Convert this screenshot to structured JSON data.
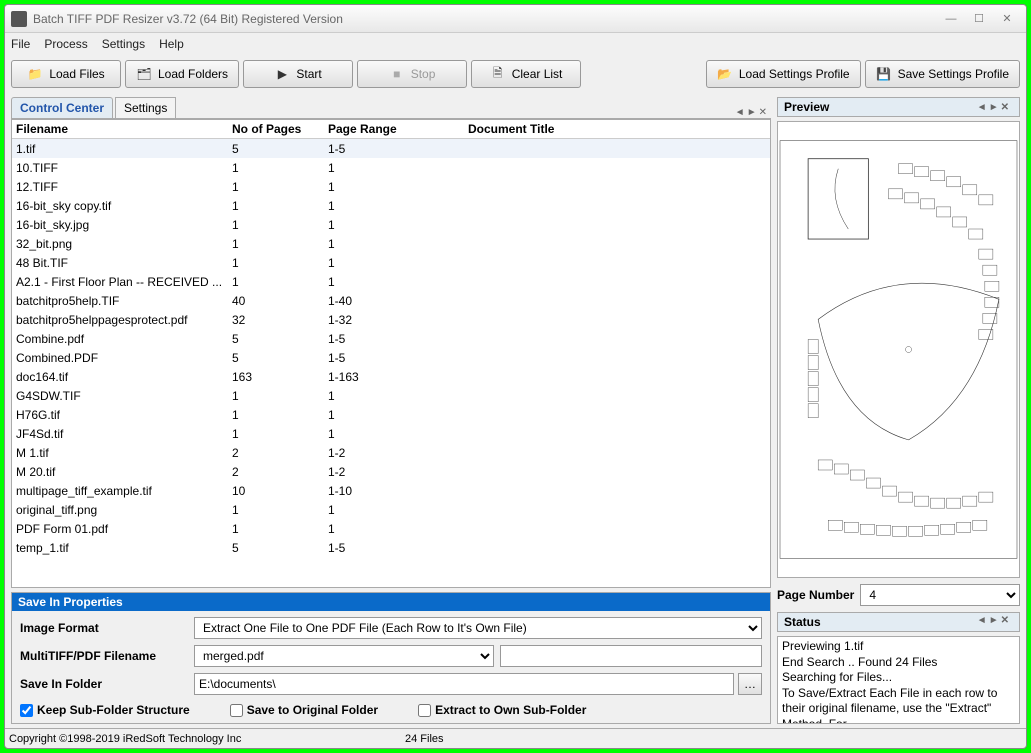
{
  "window": {
    "title": "Batch TIFF PDF Resizer v3.72 (64 Bit)  Registered Version"
  },
  "menu": {
    "file": "File",
    "process": "Process",
    "settings": "Settings",
    "help": "Help"
  },
  "toolbar": {
    "load_files": "Load Files",
    "load_folders": "Load Folders",
    "start": "Start",
    "stop": "Stop",
    "clear_list": "Clear List",
    "load_profile": "Load Settings Profile",
    "save_profile": "Save Settings Profile"
  },
  "tabs": {
    "control_center": "Control Center",
    "settings": "Settings"
  },
  "table": {
    "headers": {
      "filename": "Filename",
      "pages": "No of Pages",
      "range": "Page Range",
      "title": "Document Title"
    },
    "rows": [
      {
        "f": "1.tif",
        "p": "5",
        "r": "1-5",
        "t": ""
      },
      {
        "f": "10.TIFF",
        "p": "1",
        "r": "1",
        "t": ""
      },
      {
        "f": "12.TIFF",
        "p": "1",
        "r": "1",
        "t": ""
      },
      {
        "f": "16-bit_sky copy.tif",
        "p": "1",
        "r": "1",
        "t": ""
      },
      {
        "f": "16-bit_sky.jpg",
        "p": "1",
        "r": "1",
        "t": ""
      },
      {
        "f": "32_bit.png",
        "p": "1",
        "r": "1",
        "t": ""
      },
      {
        "f": "48 Bit.TIF",
        "p": "1",
        "r": "1",
        "t": ""
      },
      {
        "f": "A2.1 - First Floor Plan -- RECEIVED ...",
        "p": "1",
        "r": "1",
        "t": ""
      },
      {
        "f": "batchitpro5help.TIF",
        "p": "40",
        "r": "1-40",
        "t": ""
      },
      {
        "f": "batchitpro5helppagesprotect.pdf",
        "p": "32",
        "r": "1-32",
        "t": ""
      },
      {
        "f": "Combine.pdf",
        "p": "5",
        "r": "1-5",
        "t": ""
      },
      {
        "f": "Combined.PDF",
        "p": "5",
        "r": "1-5",
        "t": ""
      },
      {
        "f": "doc164.tif",
        "p": "163",
        "r": "1-163",
        "t": ""
      },
      {
        "f": "G4SDW.TIF",
        "p": "1",
        "r": "1",
        "t": ""
      },
      {
        "f": "H76G.tif",
        "p": "1",
        "r": "1",
        "t": ""
      },
      {
        "f": "JF4Sd.tif",
        "p": "1",
        "r": "1",
        "t": ""
      },
      {
        "f": "M 1.tif",
        "p": "2",
        "r": "1-2",
        "t": ""
      },
      {
        "f": "M 20.tif",
        "p": "2",
        "r": "1-2",
        "t": ""
      },
      {
        "f": "multipage_tiff_example.tif",
        "p": "10",
        "r": "1-10",
        "t": ""
      },
      {
        "f": "original_tiff.png",
        "p": "1",
        "r": "1",
        "t": ""
      },
      {
        "f": "PDF Form 01.pdf",
        "p": "1",
        "r": "1",
        "t": ""
      },
      {
        "f": "temp_1.tif",
        "p": "5",
        "r": "1-5",
        "t": ""
      }
    ]
  },
  "save_panel": {
    "title": "Save In Properties",
    "image_format_label": "Image Format",
    "image_format_value": "Extract One File to One PDF File (Each Row to It's Own File)",
    "multitiff_label": "MultiTIFF/PDF Filename",
    "multitiff_value": "merged.pdf",
    "multitiff_extra": "",
    "folder_label": "Save In Folder",
    "folder_value": "E:\\documents\\",
    "keep_sub": "Keep Sub-Folder Structure",
    "save_orig": "Save to Original Folder",
    "extract_own": "Extract to Own Sub-Folder"
  },
  "preview": {
    "title": "Preview",
    "page_label": "Page Number",
    "page_value": "4"
  },
  "status": {
    "title": "Status",
    "lines": [
      "Previewing 1.tif",
      "End Search .. Found 24 Files",
      "Searching for Files...",
      "To Save/Extract Each File in each row to their original filename, use the \"Extract\" Method. For"
    ]
  },
  "statusbar": {
    "copyright": "Copyright ©1998-2019 iRedSoft Technology Inc",
    "files": "24 Files"
  }
}
